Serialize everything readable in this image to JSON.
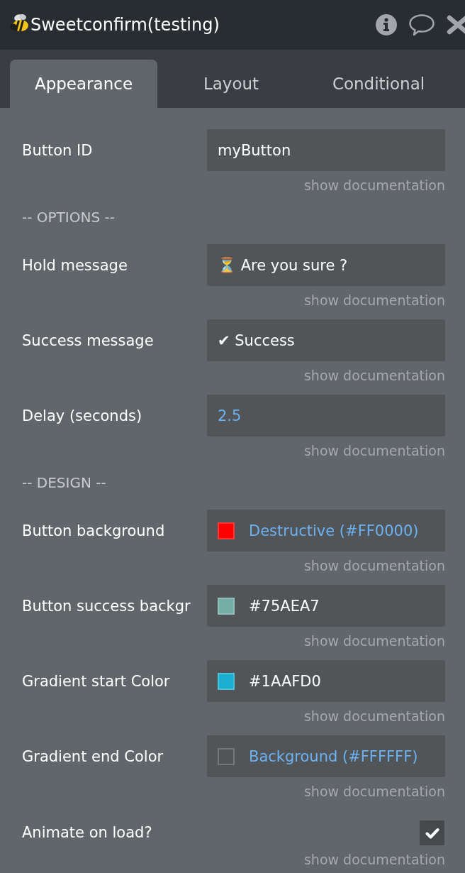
{
  "header": {
    "title": "Sweetconfirm(testing)"
  },
  "tabs": [
    {
      "label": "Appearance",
      "selected": true
    },
    {
      "label": "Layout",
      "selected": false
    },
    {
      "label": "Conditional",
      "selected": false
    }
  ],
  "properties": [
    {
      "kind": "text",
      "label": "Button ID",
      "value": "myButton",
      "dynamic": false,
      "doc_link": "show documentation"
    },
    {
      "kind": "section",
      "label": "-- OPTIONS --"
    },
    {
      "kind": "text",
      "label": "Hold message",
      "value": "⏳ Are you sure ?",
      "dynamic": false,
      "doc_link": "show documentation"
    },
    {
      "kind": "text",
      "label": "Success message",
      "value": "✔ Success",
      "dynamic": false,
      "doc_link": "show documentation"
    },
    {
      "kind": "text",
      "label": "Delay (seconds)",
      "value": "2.5",
      "dynamic": true,
      "doc_link": "show documentation"
    },
    {
      "kind": "section",
      "label": "-- DESIGN --"
    },
    {
      "kind": "color",
      "label": "Button background",
      "value": "Destructive (#FF0000)",
      "color": "#ff0000",
      "dynamic": true,
      "doc_link": "show documentation"
    },
    {
      "kind": "color",
      "label": "Button success backgr",
      "value": "#75AEA7",
      "color": "#75aea7",
      "dynamic": false,
      "doc_link": "show documentation"
    },
    {
      "kind": "color",
      "label": "Gradient start Color",
      "value": "#1AAFD0",
      "color": "#1aafd0",
      "dynamic": false,
      "doc_link": "show documentation"
    },
    {
      "kind": "color",
      "label": "Gradient end Color",
      "value": "Background (#FFFFFF)",
      "dynamic": true,
      "doc_link": "show documentation"
    },
    {
      "kind": "checkbox",
      "label": "Animate on load?",
      "checked": true,
      "doc_link": "show documentation"
    }
  ]
}
